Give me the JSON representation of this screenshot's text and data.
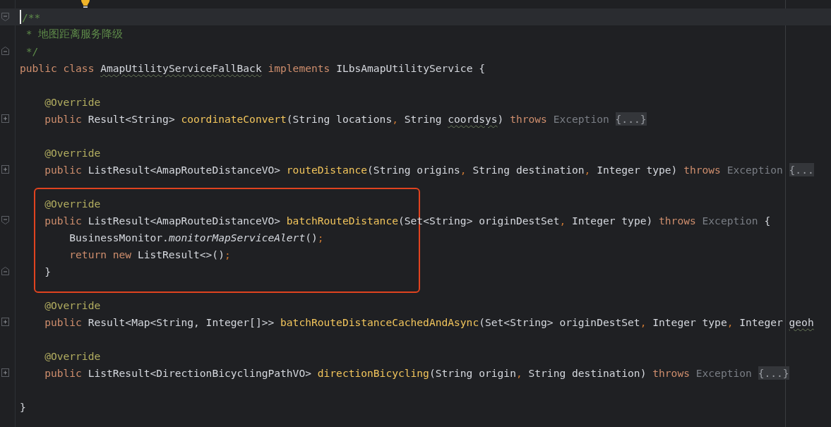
{
  "editor": {
    "blocks": [
      {
        "highlighted": false,
        "lines": [
          {
            "fold_marker": {
              "kind": "start",
              "expanded": true
            },
            "current": true,
            "tokens": [
              {
                "kind": "comment",
                "text": "/**"
              }
            ]
          },
          {
            "current": false,
            "tokens": [
              {
                "kind": "comment",
                "text": " * 地图距离服务降级"
              }
            ]
          },
          {
            "fold_marker": {
              "kind": "end",
              "expanded": true
            },
            "current": false,
            "tokens": [
              {
                "kind": "comment",
                "text": " */"
              }
            ]
          },
          {
            "current": false,
            "tokens": [
              {
                "kind": "kw",
                "text": "public class "
              },
              {
                "kind": "plain",
                "text": "AmapUtilityServiceFallBack",
                "warn": true
              },
              {
                "kind": "kw",
                "text": " implements "
              },
              {
                "kind": "plain",
                "text": "ILbsAmapUtilityService {"
              }
            ]
          },
          {
            "current": false
          },
          {
            "current": false,
            "tokens": [
              {
                "kind": "ann",
                "text": "    @Override"
              }
            ]
          },
          {
            "fold_marker": {
              "kind": "start",
              "expanded": false
            },
            "current": false,
            "tokens": [
              {
                "kind": "kw",
                "text": "    public "
              },
              {
                "kind": "plain",
                "text": "Result<String> "
              },
              {
                "kind": "fn",
                "text": "coordinateConvert"
              },
              {
                "kind": "plain",
                "text": "(String locations"
              },
              {
                "kind": "punct",
                "text": ", "
              },
              {
                "kind": "plain",
                "text": "String "
              },
              {
                "kind": "plain",
                "text": "coordsys",
                "warn": true
              },
              {
                "kind": "plain",
                "text": ") "
              },
              {
                "kind": "kw",
                "text": "throws "
              },
              {
                "kind": "dim",
                "text": "Exception "
              },
              {
                "kind": "folded",
                "text": "{...}"
              }
            ]
          },
          {
            "current": false
          },
          {
            "current": false,
            "tokens": [
              {
                "kind": "ann",
                "text": "    @Override"
              }
            ]
          },
          {
            "fold_marker": {
              "kind": "start",
              "expanded": false
            },
            "current": false,
            "tokens": [
              {
                "kind": "kw",
                "text": "    public "
              },
              {
                "kind": "plain",
                "text": "ListResult<AmapRouteDistanceVO> "
              },
              {
                "kind": "fn",
                "text": "routeDistance"
              },
              {
                "kind": "plain",
                "text": "(String origins"
              },
              {
                "kind": "punct",
                "text": ", "
              },
              {
                "kind": "plain",
                "text": "String destination"
              },
              {
                "kind": "punct",
                "text": ", "
              },
              {
                "kind": "plain",
                "text": "Integer type) "
              },
              {
                "kind": "kw",
                "text": "throws "
              },
              {
                "kind": "dim",
                "text": "Exception "
              },
              {
                "kind": "folded",
                "text": "{..."
              }
            ]
          },
          {
            "current": false
          }
        ]
      },
      {
        "highlighted": true,
        "lines": [
          {
            "current": false,
            "tokens": [
              {
                "kind": "ann",
                "text": "    @Override"
              }
            ]
          },
          {
            "fold_marker": {
              "kind": "start",
              "expanded": true
            },
            "current": false,
            "tokens": [
              {
                "kind": "kw",
                "text": "    public "
              },
              {
                "kind": "plain",
                "text": "ListResult<AmapRouteDistanceVO> "
              },
              {
                "kind": "fn",
                "text": "batchRouteDistance"
              },
              {
                "kind": "plain",
                "text": "(Set<String> originDestSet"
              },
              {
                "kind": "punct",
                "text": ", "
              },
              {
                "kind": "plain",
                "text": "Integer type) "
              },
              {
                "kind": "kw",
                "text": "throws "
              },
              {
                "kind": "dim",
                "text": "Exception "
              },
              {
                "kind": "plain",
                "text": "{"
              }
            ]
          },
          {
            "current": false,
            "tokens": [
              {
                "kind": "plain",
                "text": "        BusinessMonitor."
              },
              {
                "kind": "italic",
                "text": "monitorMapServiceAlert"
              },
              {
                "kind": "plain",
                "text": "()"
              },
              {
                "kind": "punct",
                "text": ";"
              }
            ]
          },
          {
            "current": false,
            "tokens": [
              {
                "kind": "kw",
                "text": "        return new "
              },
              {
                "kind": "plain",
                "text": "ListResult<>()"
              },
              {
                "kind": "punct",
                "text": ";"
              }
            ]
          },
          {
            "fold_marker": {
              "kind": "end",
              "expanded": true
            },
            "current": false,
            "tokens": [
              {
                "kind": "plain",
                "text": "    }"
              }
            ]
          }
        ]
      },
      {
        "highlighted": false,
        "lines": [
          {
            "current": false
          },
          {
            "current": false,
            "tokens": [
              {
                "kind": "ann",
                "text": "    @Override"
              }
            ]
          },
          {
            "fold_marker": {
              "kind": "start",
              "expanded": false
            },
            "current": false,
            "tokens": [
              {
                "kind": "kw",
                "text": "    public "
              },
              {
                "kind": "plain",
                "text": "Result<Map<String, Integer[]>> "
              },
              {
                "kind": "fn",
                "text": "batchRouteDistanceCachedAndAsync"
              },
              {
                "kind": "plain",
                "text": "(Set<String> originDestSet"
              },
              {
                "kind": "punct",
                "text": ", "
              },
              {
                "kind": "plain",
                "text": "Integer type"
              },
              {
                "kind": "punct",
                "text": ", "
              },
              {
                "kind": "plain",
                "text": "Integer "
              },
              {
                "kind": "plain",
                "text": "geoh",
                "warn": true
              }
            ]
          },
          {
            "current": false
          },
          {
            "current": false,
            "tokens": [
              {
                "kind": "ann",
                "text": "    @Override"
              }
            ]
          },
          {
            "fold_marker": {
              "kind": "start",
              "expanded": false
            },
            "current": false,
            "tokens": [
              {
                "kind": "kw",
                "text": "    public "
              },
              {
                "kind": "plain",
                "text": "ListResult<DirectionBicyclingPathVO> "
              },
              {
                "kind": "fn",
                "text": "directionBicycling"
              },
              {
                "kind": "plain",
                "text": "(String origin"
              },
              {
                "kind": "punct",
                "text": ", "
              },
              {
                "kind": "plain",
                "text": "String destination) "
              },
              {
                "kind": "kw",
                "text": "throws "
              },
              {
                "kind": "dim",
                "text": "Exception "
              },
              {
                "kind": "folded",
                "text": "{...}"
              }
            ]
          },
          {
            "current": false
          },
          {
            "current": false,
            "tokens": [
              {
                "kind": "plain",
                "text": "}"
              }
            ]
          }
        ]
      }
    ]
  }
}
